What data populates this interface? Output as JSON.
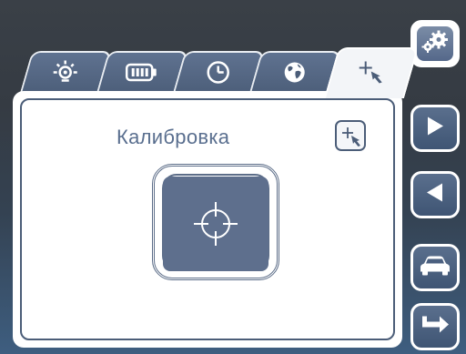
{
  "tabs": [
    {
      "icon": "brightness-icon",
      "active": false
    },
    {
      "icon": "battery-icon",
      "active": false
    },
    {
      "icon": "clock-icon",
      "active": false
    },
    {
      "icon": "globe-icon",
      "active": false
    },
    {
      "icon": "calibration-touch-icon",
      "active": true
    }
  ],
  "panel": {
    "title": "Калибровка",
    "corner_icon": "calibration-touch-icon",
    "target_icon": "crosshair-icon"
  },
  "side_buttons": [
    {
      "icon": "gears-icon"
    },
    {
      "icon": "play-next-icon"
    },
    {
      "icon": "play-prev-icon"
    },
    {
      "icon": "car-icon"
    },
    {
      "icon": "exit-arrow-icon"
    }
  ],
  "colors": {
    "accent": "#5e6f8d",
    "panel": "#ffffff",
    "text": "#5a6f8f"
  }
}
